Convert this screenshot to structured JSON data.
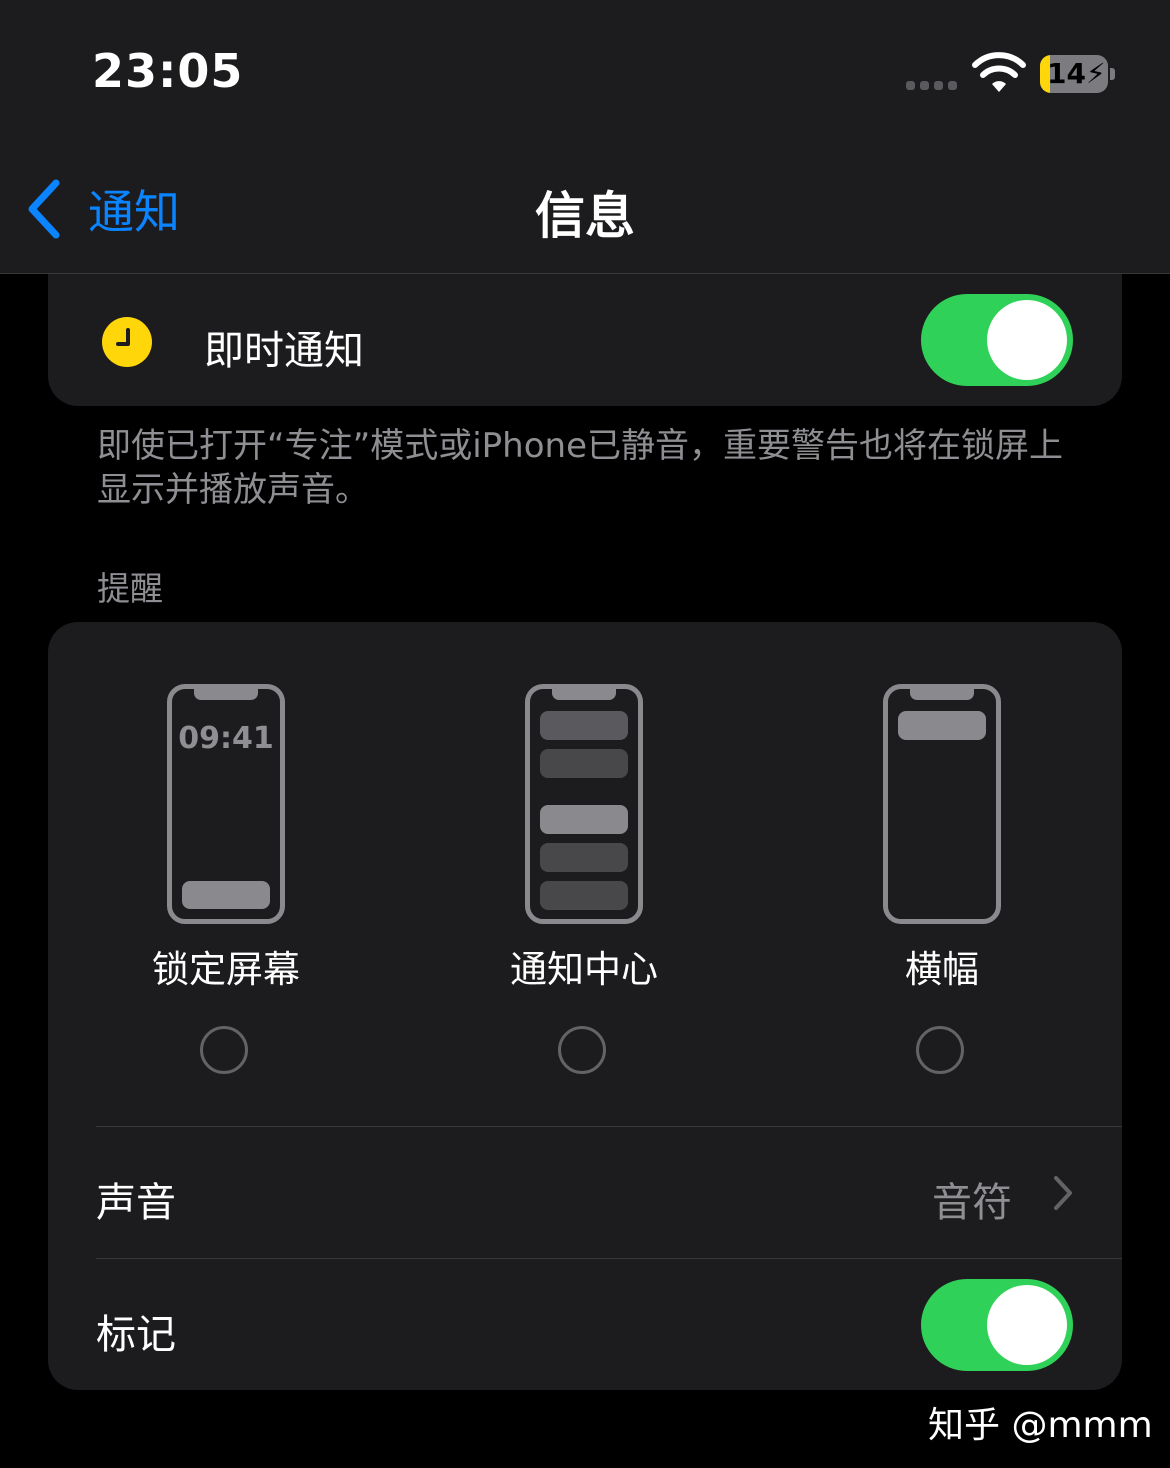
{
  "status_bar": {
    "time": "23:05",
    "battery_level": "14",
    "battery_fraction": 0.14,
    "battery_color": "#ffd60a"
  },
  "nav": {
    "back_label": "通知",
    "title": "信息"
  },
  "time_sensitive": {
    "label": "即时通知",
    "enabled": true,
    "icon": "clock-icon"
  },
  "footnote": "即使已打开“专注”模式或iPhone已静音，重要警告也将在锁屏上显示并播放声音。",
  "alerts": {
    "header": "提醒",
    "options": [
      {
        "label": "锁定屏幕",
        "preview_time": "09:41",
        "selected": false
      },
      {
        "label": "通知中心",
        "selected": false
      },
      {
        "label": "横幅",
        "selected": false
      }
    ]
  },
  "sounds": {
    "label": "声音",
    "value": "音符"
  },
  "badges": {
    "label": "标记",
    "enabled": true
  },
  "watermark": "知乎 @mmm",
  "colors": {
    "accent": "#0a84ff",
    "toggle_on": "#30d158",
    "background": "#000000",
    "card": "#1c1c1e",
    "secondary_text": "#8e8e93"
  }
}
